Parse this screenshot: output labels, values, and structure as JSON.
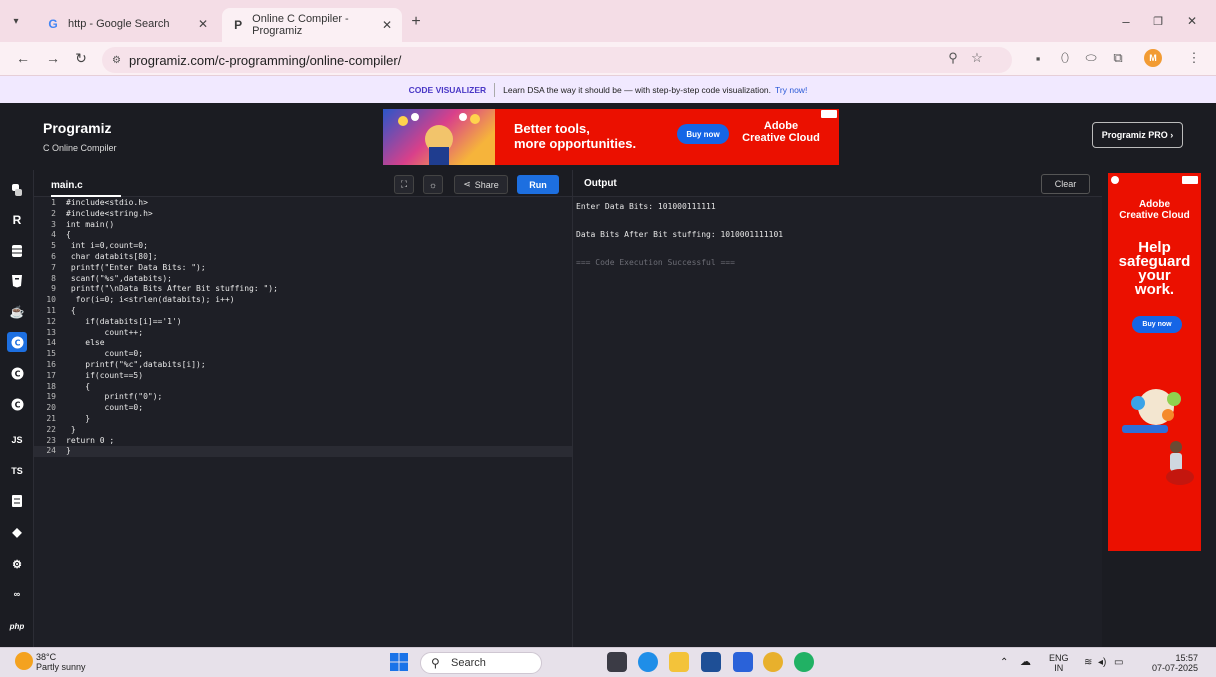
{
  "browser": {
    "tabs": [
      {
        "title": "http - Google Search",
        "favicon": "google-icon"
      },
      {
        "title": "Online C Compiler - Programiz",
        "favicon": "programiz-icon"
      }
    ],
    "url": "programiz.com/c-programming/online-compiler/",
    "profile_initial": "M"
  },
  "promo": {
    "tag": "CODE VISUALIZER",
    "text": "Learn DSA the way it should be — with step-by-step code visualization.",
    "link": "Try now!"
  },
  "header": {
    "logo": "Programiz",
    "subtitle": "C Online Compiler",
    "pro_button": "Programiz PRO ›"
  },
  "top_ad": {
    "headline_1": "Better tools,",
    "headline_2": "more opportunities.",
    "cta": "Buy now",
    "brand_1": "Adobe",
    "brand_2": "Creative Cloud"
  },
  "editor": {
    "filename": "main.c",
    "share_label": "Share",
    "run_label": "Run",
    "lines": [
      "#include<stdio.h>",
      "#include<string.h>",
      "int main()",
      "{",
      " int i=0,count=0;",
      " char databits[80];",
      " printf(\"Enter Data Bits: \");",
      " scanf(\"%s\",databits);",
      " printf(\"\\nData Bits After Bit stuffing: \");",
      "  for(i=0; i<strlen(databits); i++)",
      " {",
      "    if(databits[i]=='1')",
      "        count++;",
      "    else",
      "        count=0;",
      "    printf(\"%c\",databits[i]);",
      "    if(count==5)",
      "    {",
      "        printf(\"0\");",
      "        count=0;",
      "    }",
      " }",
      "return 0 ;",
      "}"
    ]
  },
  "output": {
    "title": "Output",
    "clear_label": "Clear",
    "lines": [
      "Enter Data Bits: 101000111111",
      "",
      "Data Bits After Bit stuffing: 1010001111101",
      "",
      "=== Code Execution Successful ==="
    ]
  },
  "side_ad": {
    "brand_1": "Adobe",
    "brand_2": "Creative Cloud",
    "help": [
      "Help",
      "safeguard",
      "your",
      "work."
    ],
    "cta": "Buy now"
  },
  "rail": [
    "python-icon",
    "r-icon",
    "sql-icon",
    "html-icon",
    "java-icon",
    "c-icon",
    "cpp-icon",
    "csharp-icon",
    "js-icon",
    "ts-icon",
    "go-icon",
    "swift-icon",
    "rust-icon",
    "kotlin-icon",
    "php-icon"
  ],
  "rail_labels": {
    "js": "JS",
    "ts": "TS",
    "php": "php"
  },
  "taskbar": {
    "temperature": "38°C",
    "weather": "Partly sunny",
    "search": "Search",
    "lang_1": "ENG",
    "lang_2": "IN",
    "time": "15:57",
    "date": "07-07-2025"
  }
}
